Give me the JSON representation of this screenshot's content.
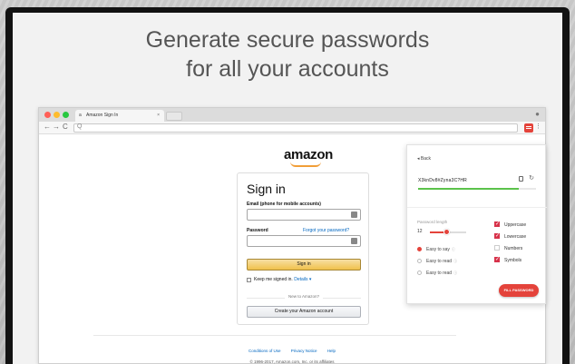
{
  "headline": {
    "line1": "Generate secure passwords",
    "line2": "for all your accounts"
  },
  "browser": {
    "tab_title": "Amazon Sign In",
    "tab_close": "×",
    "nav": {
      "back": "←",
      "forward": "→",
      "reload": "C"
    },
    "url_search_icon": "Q",
    "extension_icon": "password-manager-icon",
    "menu": "⋮"
  },
  "amazon": {
    "logo": "amazon",
    "title": "Sign in",
    "email_label": "Email (phone for mobile accounts)",
    "email_value": "",
    "password_label": "Password",
    "forgot_link": "Forgot your password?",
    "password_value": "",
    "signin_button": "Sign in",
    "keep_signed_in": "Keep me signed in.",
    "details_link": "Details",
    "details_caret": "▾",
    "new_to_amazon": "New to Amazon?",
    "create_button": "Create your Amazon account",
    "footer_links": [
      "Conditions of Use",
      "Privacy Notice",
      "Help"
    ],
    "copyright": "© 1996-2017, Amazon.com, Inc. or its affiliates"
  },
  "generator": {
    "back": "◂  Back",
    "password": "X3knDv8#Zyna3C?HR",
    "strength": 0.85,
    "length_label": "Password length",
    "length_value": "12",
    "length_fraction": 0.45,
    "options_left": [
      {
        "label": "Easy to say",
        "selected": true,
        "info": "ⓘ"
      },
      {
        "label": "Easy to read",
        "selected": false,
        "info": "ⓘ"
      },
      {
        "label": "Easy to read",
        "selected": false,
        "info": "ⓘ"
      }
    ],
    "options_right": [
      {
        "label": "Uppercase",
        "checked": true
      },
      {
        "label": "Lowercase",
        "checked": true
      },
      {
        "label": "Numbers",
        "checked": false
      },
      {
        "label": "Symbols",
        "checked": true
      }
    ],
    "fill_button": "FILL PASSWORD",
    "accent_color": "#e4433b",
    "strength_color": "#5bc24b"
  }
}
